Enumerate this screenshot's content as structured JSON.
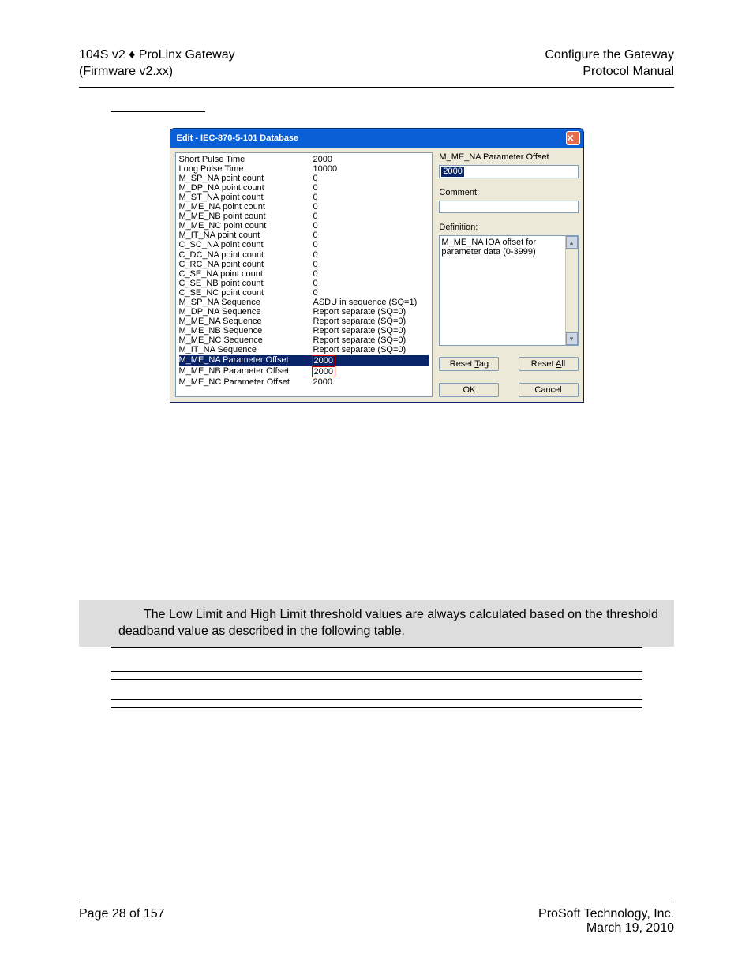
{
  "header": {
    "left_line1": "104S v2 ♦ ProLinx Gateway",
    "left_line2": "(Firmware v2.xx)",
    "right_line1": "Configure the Gateway",
    "right_line2": "Protocol Manual"
  },
  "dialog": {
    "title": "Edit - IEC-870-5-101 Database",
    "close_glyph": "✕",
    "rows": [
      {
        "k": "Short Pulse Time",
        "v": "2000",
        "sel": false
      },
      {
        "k": "Long Pulse Time",
        "v": "10000",
        "sel": false
      },
      {
        "k": "M_SP_NA point count",
        "v": "0",
        "sel": false
      },
      {
        "k": "M_DP_NA point count",
        "v": "0",
        "sel": false
      },
      {
        "k": "M_ST_NA point count",
        "v": "0",
        "sel": false
      },
      {
        "k": "M_ME_NA point count",
        "v": "0",
        "sel": false
      },
      {
        "k": "M_ME_NB point count",
        "v": "0",
        "sel": false
      },
      {
        "k": "M_ME_NC point count",
        "v": "0",
        "sel": false
      },
      {
        "k": "M_IT_NA point count",
        "v": "0",
        "sel": false
      },
      {
        "k": "C_SC_NA point count",
        "v": "0",
        "sel": false
      },
      {
        "k": "C_DC_NA point count",
        "v": "0",
        "sel": false
      },
      {
        "k": "C_RC_NA point count",
        "v": "0",
        "sel": false
      },
      {
        "k": "C_SE_NA point count",
        "v": "0",
        "sel": false
      },
      {
        "k": "C_SE_NB point count",
        "v": "0",
        "sel": false
      },
      {
        "k": "C_SE_NC point count",
        "v": "0",
        "sel": false
      },
      {
        "k": "M_SP_NA Sequence",
        "v": "ASDU in sequence (SQ=1)",
        "sel": false
      },
      {
        "k": "M_DP_NA Sequence",
        "v": "Report separate (SQ=0)",
        "sel": false
      },
      {
        "k": "M_ME_NA Sequence",
        "v": "Report separate (SQ=0)",
        "sel": false
      },
      {
        "k": "M_ME_NB Sequence",
        "v": "Report separate (SQ=0)",
        "sel": false
      },
      {
        "k": "M_ME_NC Sequence",
        "v": "Report separate (SQ=0)",
        "sel": false
      },
      {
        "k": "M_IT_NA Sequence",
        "v": "Report separate (SQ=0)",
        "sel": false
      },
      {
        "k": "M_ME_NA Parameter Offset",
        "v": "2000",
        "sel": true,
        "hl": true
      },
      {
        "k": "M_ME_NB Parameter Offset",
        "v": "2000",
        "sel": false,
        "hl": true
      },
      {
        "k": "M_ME_NC Parameter Offset",
        "v": "2000",
        "sel": false
      }
    ],
    "right": {
      "param_label": "M_ME_NA Parameter Offset",
      "param_value": "2000",
      "comment_label": "Comment:",
      "comment_value": "",
      "definition_label": "Definition:",
      "definition_text": "M_ME_NA IOA offset for parameter data (0-3999)",
      "buttons": {
        "reset_tag": "Reset Tag",
        "reset_all": "Reset All",
        "ok": "OK",
        "cancel": "Cancel"
      }
    }
  },
  "note_text": "The Low Limit and High Limit threshold values are always calculated based on the threshold deadband value as described in the following table.",
  "footer": {
    "left": "Page 28 of 157",
    "right_line1": "ProSoft Technology, Inc.",
    "right_line2": "March 19, 2010"
  }
}
